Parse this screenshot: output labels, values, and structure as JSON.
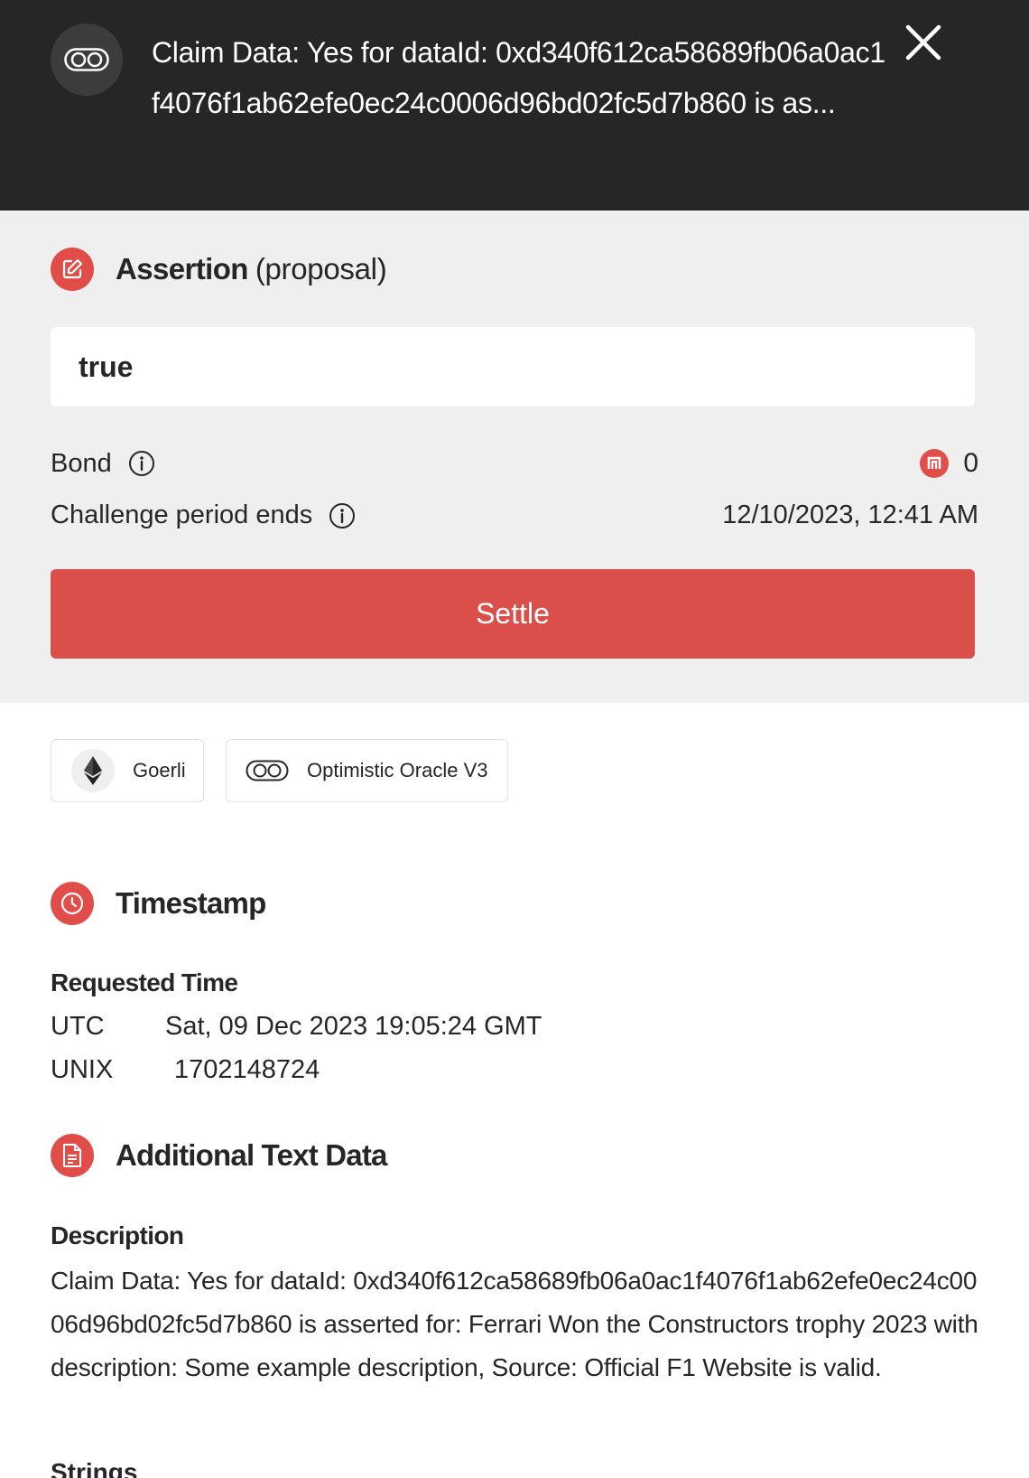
{
  "header": {
    "title": "Claim Data: Yes for dataId: 0xd340f612ca58689fb06a0ac1f4076f1ab62efe0ec24c0006d96bd02fc5d7b860 is as...",
    "oracle_icon": "oracle-logo-icon",
    "close_icon": "close-icon"
  },
  "assertion": {
    "title": "Assertion",
    "subtitle": "(proposal)",
    "value": "true",
    "bond_label": "Bond",
    "bond_value": "0",
    "challenge_label": "Challenge period ends",
    "challenge_value": "12/10/2023, 12:41 AM",
    "settle_label": "Settle"
  },
  "chips": {
    "network": "Goerli",
    "oracle": "Optimistic Oracle V3"
  },
  "timestamp": {
    "title": "Timestamp",
    "requested_label": "Requested Time",
    "utc_label": "UTC",
    "utc_value": "Sat, 09 Dec 2023 19:05:24 GMT",
    "unix_label": "UNIX",
    "unix_value": "1702148724"
  },
  "text_data": {
    "title": "Additional Text Data",
    "description_label": "Description",
    "description": "Claim Data: Yes for dataId: 0xd340f612ca58689fb06a0ac1f4076f1ab62efe0ec24c0006d96bd02fc5d7b860 is asserted for: Ferrari Won the Constructors trophy 2023 with description: Some example description, Source: Official F1 Website is valid.",
    "strings_label": "Strings"
  },
  "colors": {
    "header_bg": "#272528",
    "accent": "#e14e49",
    "section_bg": "#efefef"
  }
}
